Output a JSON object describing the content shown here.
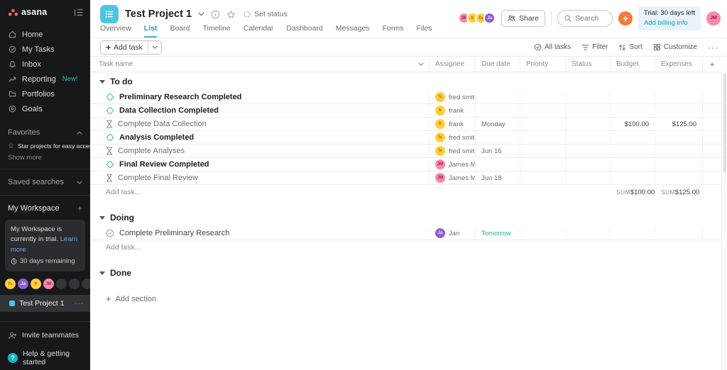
{
  "colors": {
    "accent_teal": "#2f9fb0",
    "tab_underline": "#43b9c7",
    "coral_logo": "#f06a6a",
    "omnibutton_orange": "#f4793e",
    "milestone_teal": "#58c0ab",
    "tomorrow_green": "#27ab9b",
    "project_icon_cyan": "#4cc5e2",
    "new_badge_teal": "#26c0a0",
    "trial_box_bg": "#e8f3fb",
    "billing_link": "#0e9fc1",
    "learn_more_blue": "#69a8e8"
  },
  "sidebar": {
    "logo": "asana",
    "nav": [
      {
        "label": "Home",
        "icon": "home-icon"
      },
      {
        "label": "My Tasks",
        "icon": "check-circle-icon"
      },
      {
        "label": "Inbox",
        "icon": "bell-icon"
      },
      {
        "label": "Reporting",
        "icon": "chart-icon",
        "badge": "New!"
      },
      {
        "label": "Portfolios",
        "icon": "folder-icon"
      },
      {
        "label": "Goals",
        "icon": "target-icon"
      }
    ],
    "favorites": {
      "header": "Favorites",
      "hint": "Star projects for easy access",
      "show_more": "Show more"
    },
    "saved_searches": "Saved searches",
    "workspace": "My Workspace",
    "trial_card": {
      "text": "My Workspace is currently in trial.",
      "link": "Learn more",
      "remaining": "30 days remaining"
    },
    "members": [
      {
        "initials": "fs",
        "bg": "#ffce3d",
        "fg": "#a96a0e"
      },
      {
        "initials": "Ja",
        "bg": "#8c5ed6",
        "fg": "#f1eaff"
      },
      {
        "initials": "fr",
        "bg": "#ffce3d",
        "fg": "#a96a0e"
      },
      {
        "initials": "JM",
        "bg": "#f78ba8",
        "fg": "#9c1f4e"
      }
    ],
    "member_placeholders": 3,
    "project": "Test Project 1",
    "invite": "Invite teammates",
    "help": "Help & getting started"
  },
  "header": {
    "title": "Test Project 1",
    "set_status": "Set status",
    "avatars": [
      {
        "initials": "JM",
        "bg": "#f78ba8",
        "fg": "#9c1f4e"
      },
      {
        "initials": "fr",
        "bg": "#ffce3d",
        "fg": "#a96a0e"
      },
      {
        "initials": "fs",
        "bg": "#ffce3d",
        "fg": "#a96a0e"
      },
      {
        "initials": "Ja",
        "bg": "#8c5ed6",
        "fg": "#f1eaff"
      }
    ],
    "share": "Share",
    "search_placeholder": "Search",
    "trial_line1": "Trial: 30 days left",
    "trial_line2": "Add billing info",
    "user": {
      "initials": "JM",
      "bg": "#f78ba8",
      "fg": "#9c1f4e"
    },
    "tabs": [
      {
        "label": "Overview"
      },
      {
        "label": "List",
        "active": true
      },
      {
        "label": "Board"
      },
      {
        "label": "Timeline"
      },
      {
        "label": "Calendar"
      },
      {
        "label": "Dashboard"
      },
      {
        "label": "Messages"
      },
      {
        "label": "Forms"
      },
      {
        "label": "Files"
      }
    ]
  },
  "toolbar": {
    "add_task": "Add task",
    "views": [
      {
        "label": "All tasks",
        "icon": "all-tasks-icon"
      },
      {
        "label": "Filter",
        "icon": "filter-icon"
      },
      {
        "label": "Sort",
        "icon": "sort-icon"
      },
      {
        "label": "Customize",
        "icon": "customize-icon"
      }
    ],
    "overflow": "···"
  },
  "table": {
    "columns": [
      "Task name",
      "Assignee",
      "Due date",
      "Priority",
      "Status",
      "Budget",
      "Expenses"
    ],
    "plus": "+",
    "sections": [
      {
        "name": "To do",
        "tasks": [
          {
            "icon": "milestone",
            "title": "Preliminary Research Completed",
            "strong": true,
            "assignee": {
              "initials": "fs",
              "name": "fred smith",
              "bg": "#ffce3d",
              "fg": "#a96a0e"
            },
            "due": ""
          },
          {
            "icon": "milestone",
            "title": "Data Collection Completed",
            "strong": true,
            "assignee": {
              "initials": "fr",
              "name": "frank",
              "bg": "#ffce3d",
              "fg": "#a96a0e"
            },
            "due": ""
          },
          {
            "icon": "approval",
            "title": "Complete Data Collection",
            "muted": true,
            "assignee": {
              "initials": "fr",
              "name": "frank",
              "bg": "#ffce3d",
              "fg": "#a96a0e"
            },
            "due": "Monday",
            "budget": "$100.00",
            "expenses": "$125.00"
          },
          {
            "icon": "milestone",
            "title": "Analysis Completed",
            "strong": true,
            "assignee": {
              "initials": "fs",
              "name": "fred smith",
              "bg": "#ffce3d",
              "fg": "#a96a0e"
            },
            "due": ""
          },
          {
            "icon": "approval",
            "title": "Complete Analyses",
            "muted": true,
            "assignee": {
              "initials": "fs",
              "name": "fred smith",
              "bg": "#ffce3d",
              "fg": "#a96a0e"
            },
            "due": "Jun 16"
          },
          {
            "icon": "milestone",
            "title": "Final Review Completed",
            "strong": true,
            "assignee": {
              "initials": "JM",
              "name": "James M",
              "bg": "#f78ba8",
              "fg": "#9c1f4e"
            },
            "due": ""
          },
          {
            "icon": "approval",
            "title": "Complete Final Review",
            "muted": true,
            "assignee": {
              "initials": "JM",
              "name": "James M",
              "bg": "#f78ba8",
              "fg": "#9c1f4e"
            },
            "due": "Jun 18"
          }
        ],
        "add_task": "Add task...",
        "sums": {
          "label": "SUM",
          "budget": "$100.00",
          "expenses": "$125.00"
        }
      },
      {
        "name": "Doing",
        "tasks": [
          {
            "icon": "check",
            "title": "Complete Preliminary Research",
            "assignee": {
              "initials": "Ja",
              "name": "Jan",
              "bg": "#8c5ed6",
              "fg": "#f1eaff"
            },
            "due": "Tomorrow",
            "due_color": "#27ab9b"
          }
        ],
        "add_task": "Add task..."
      },
      {
        "name": "Done",
        "tasks": []
      }
    ],
    "add_section": "Add section"
  }
}
